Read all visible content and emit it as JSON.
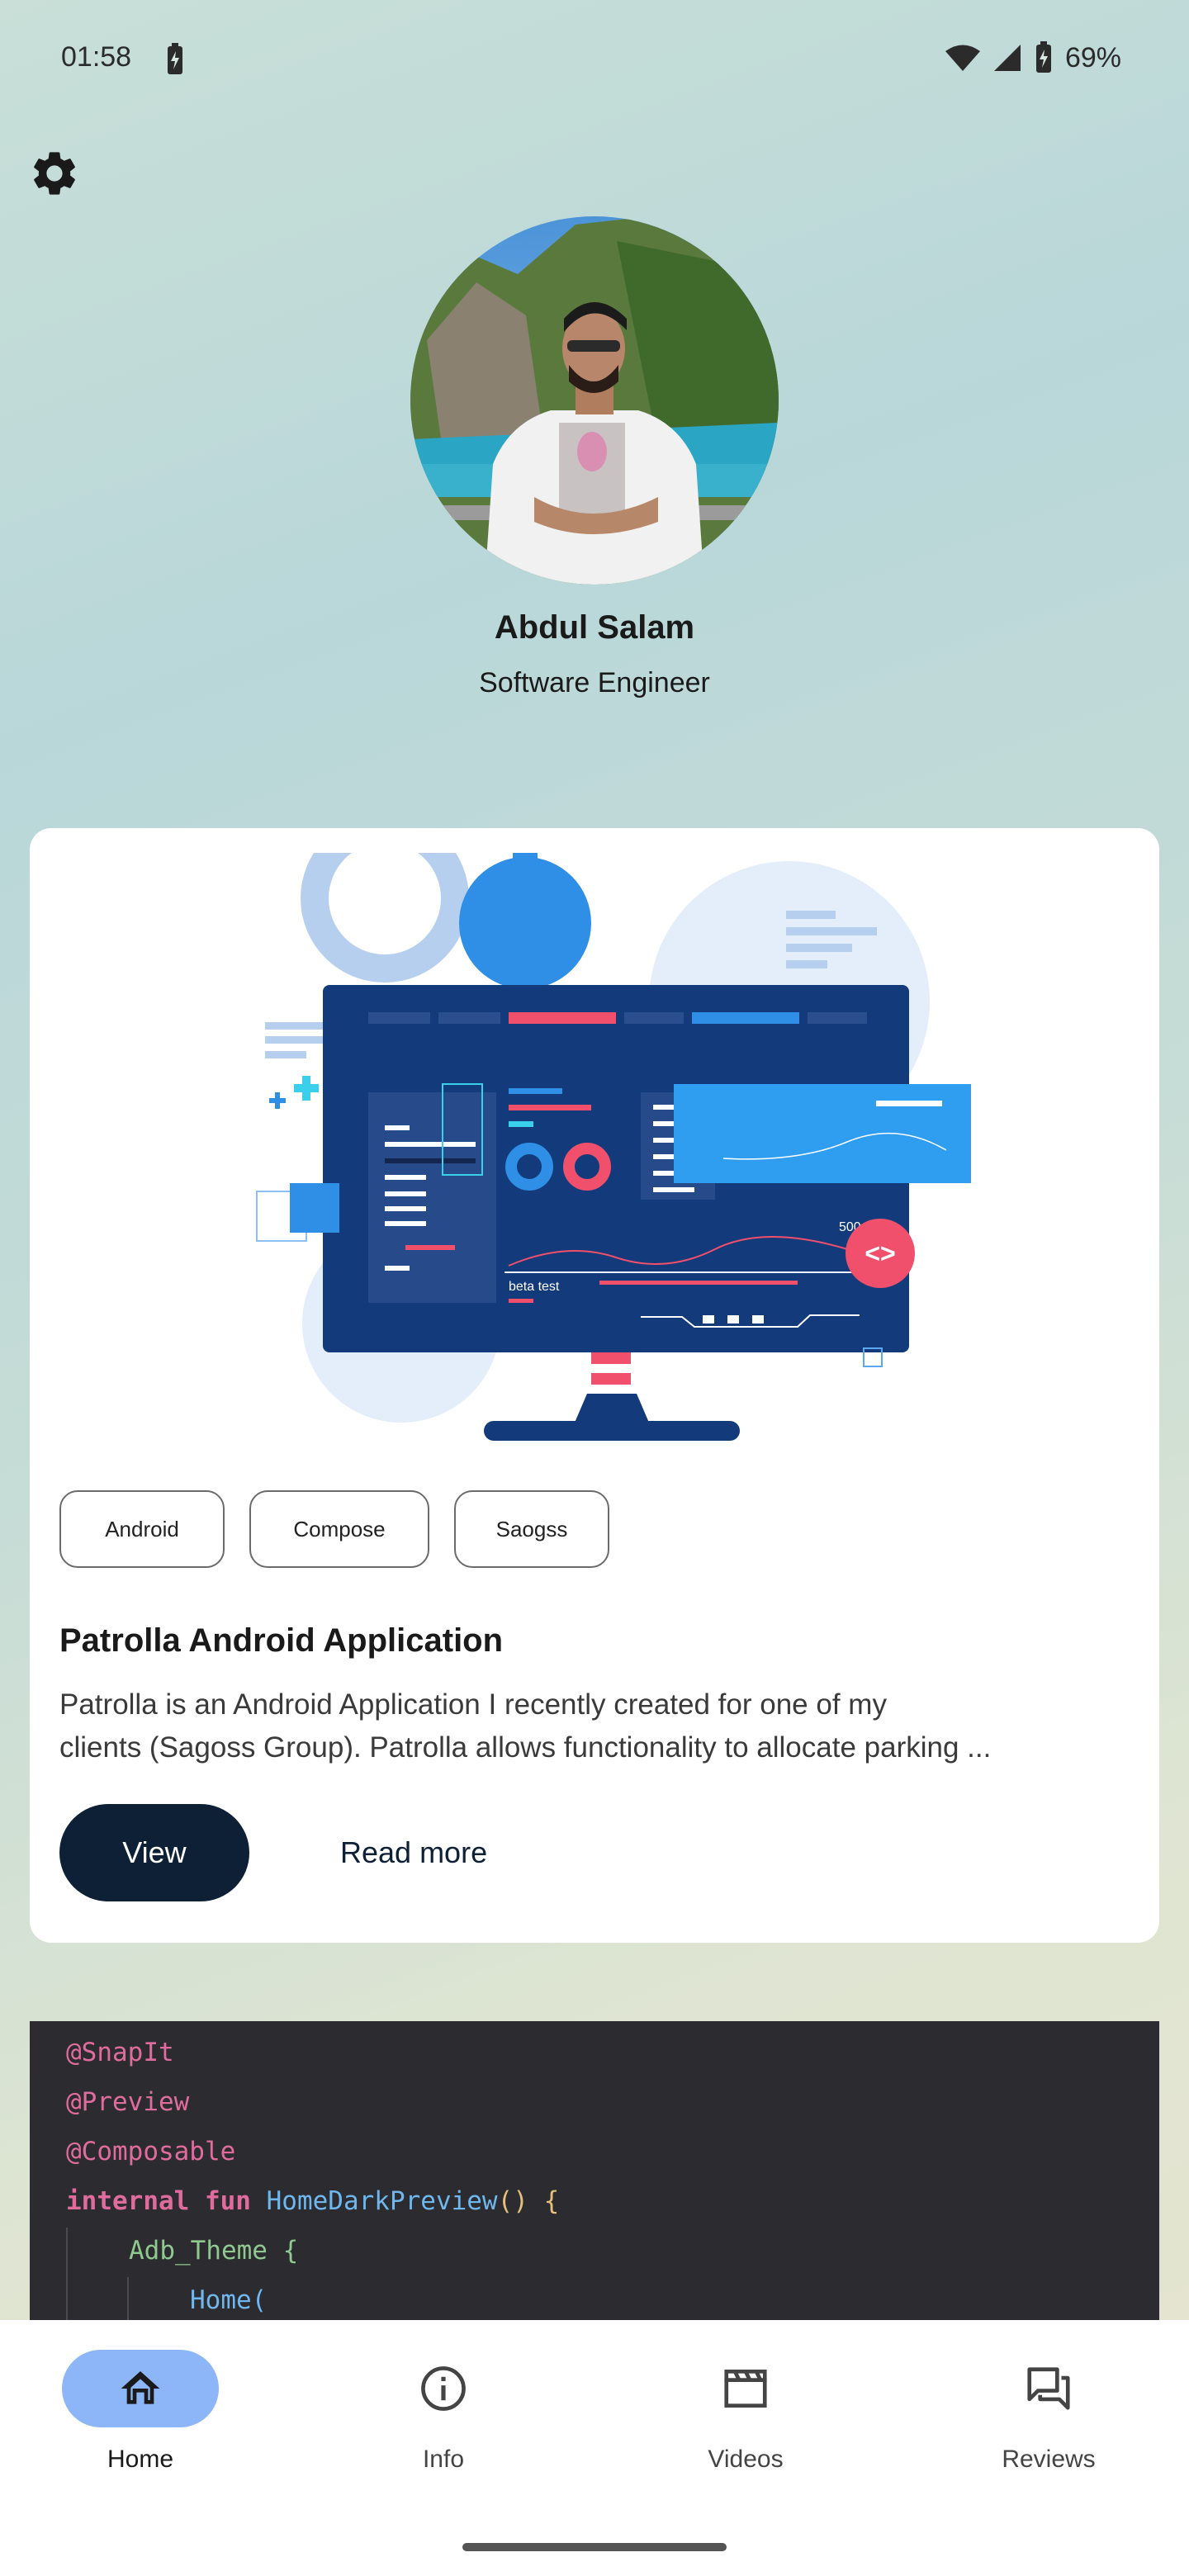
{
  "status_bar": {
    "time": "01:58",
    "battery": "69%"
  },
  "profile": {
    "name": "Abdul Salam",
    "role": "Software Engineer"
  },
  "project_card": {
    "tags": [
      "Android",
      "Compose",
      "Saogss"
    ],
    "title": "Patrolla Android Application",
    "description_line1": "Patrolla is an Android Application I recently created for one of my",
    "description_line2": "clients (Sagoss Group). Patrolla allows functionality to allocate parking ...",
    "view_label": "View",
    "read_more_label": "Read more",
    "illustration_text": {
      "value": "500",
      "beta": "beta test",
      "code_badge": "<>"
    }
  },
  "code_snippet": {
    "line1": "@SnapIt",
    "line2": "@Preview",
    "line3": "@Composable",
    "line4_kw": "internal fun ",
    "line4_fn": "HomeDarkPreview",
    "line4_rest": "() {",
    "line5_fn": "Adb_Theme",
    "line5_rest": " {",
    "line6": "Home("
  },
  "bottom_nav": {
    "items": [
      {
        "label": "Home",
        "icon": "home-icon",
        "active": true
      },
      {
        "label": "Info",
        "icon": "info-icon",
        "active": false
      },
      {
        "label": "Videos",
        "icon": "clapperboard-icon",
        "active": false
      },
      {
        "label": "Reviews",
        "icon": "chat-icon",
        "active": false
      }
    ]
  },
  "colors": {
    "accent": "#8cb6f7",
    "primary_button": "#0d2035",
    "code_bg": "#2b2b30"
  }
}
